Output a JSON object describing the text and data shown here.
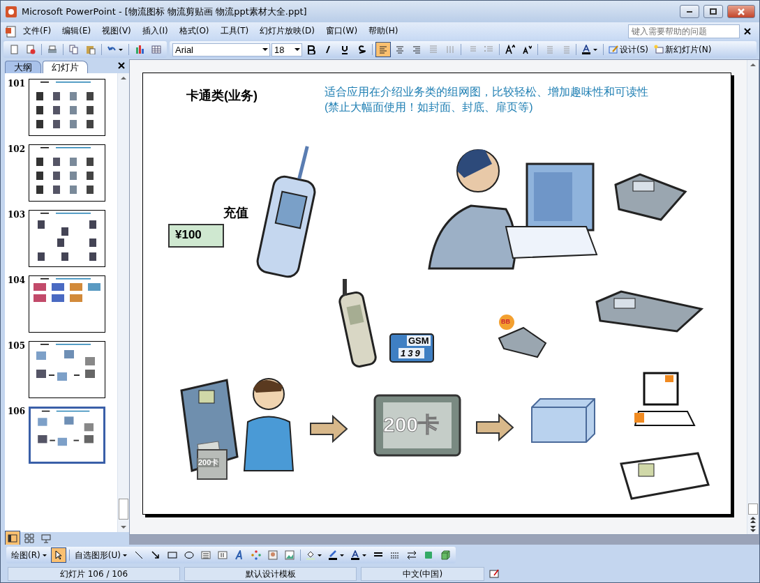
{
  "window": {
    "title": "Microsoft PowerPoint - [物流图标 物流剪贴画 物流ppt素材大全.ppt]"
  },
  "menu": [
    "文件(F)",
    "编辑(E)",
    "视图(V)",
    "插入(I)",
    "格式(O)",
    "工具(T)",
    "幻灯片放映(D)",
    "窗口(W)",
    "帮助(H)"
  ],
  "help_search": {
    "placeholder": "键入需要帮助的问题"
  },
  "formatting": {
    "font": "Arial",
    "size": "18",
    "alignment": [
      {
        "kind": "left",
        "selected": true
      },
      {
        "kind": "center",
        "selected": false
      },
      {
        "kind": "right",
        "selected": false
      }
    ],
    "design": "设计(S)",
    "new_slide": "新幻灯片(N)"
  },
  "pane": {
    "tabs": [
      {
        "label": "大纲",
        "selected": false
      },
      {
        "label": "幻灯片",
        "selected": true
      }
    ],
    "slides": [
      {
        "number": "101",
        "kind": "clipart",
        "selected": false
      },
      {
        "number": "102",
        "kind": "clipart",
        "selected": false
      },
      {
        "number": "103",
        "kind": "sparse",
        "selected": false
      },
      {
        "number": "104",
        "kind": "photos",
        "selected": false
      },
      {
        "number": "105",
        "kind": "diagram",
        "selected": false
      },
      {
        "number": "106",
        "kind": "diagram",
        "selected": true
      }
    ]
  },
  "slide": {
    "title": "卡通类(业务)",
    "description": [
      "适合应用在介绍业务类的组网图，比较轻松、增加趣味性和可读性",
      "(禁止大幅面使用！如封面、封底、扉页等)"
    ],
    "art": [
      {
        "kind": "money",
        "text": "¥100"
      },
      {
        "kind": "label",
        "text": "充值"
      },
      {
        "kind": "cellphone"
      },
      {
        "kind": "operator"
      },
      {
        "kind": "fax"
      },
      {
        "kind": "mobile"
      },
      {
        "kind": "gsm",
        "text": "GSM",
        "sub": "139"
      },
      {
        "kind": "pager",
        "text": "BB"
      },
      {
        "kind": "fax"
      },
      {
        "kind": "desk-phone"
      },
      {
        "kind": "caller",
        "text": "200卡"
      },
      {
        "kind": "arrow"
      },
      {
        "kind": "screen",
        "text": "200卡"
      },
      {
        "kind": "arrow"
      },
      {
        "kind": "box"
      },
      {
        "kind": "computer"
      },
      {
        "kind": "desk-phone"
      }
    ]
  },
  "drawing_toolbar": {
    "draw": "绘图(R)",
    "autoshapes": "自选图形(U)",
    "pointer_selected": true
  },
  "status_bar": [
    "幻灯片 106 / 106",
    "默认设计模板",
    "中文(中国)"
  ]
}
